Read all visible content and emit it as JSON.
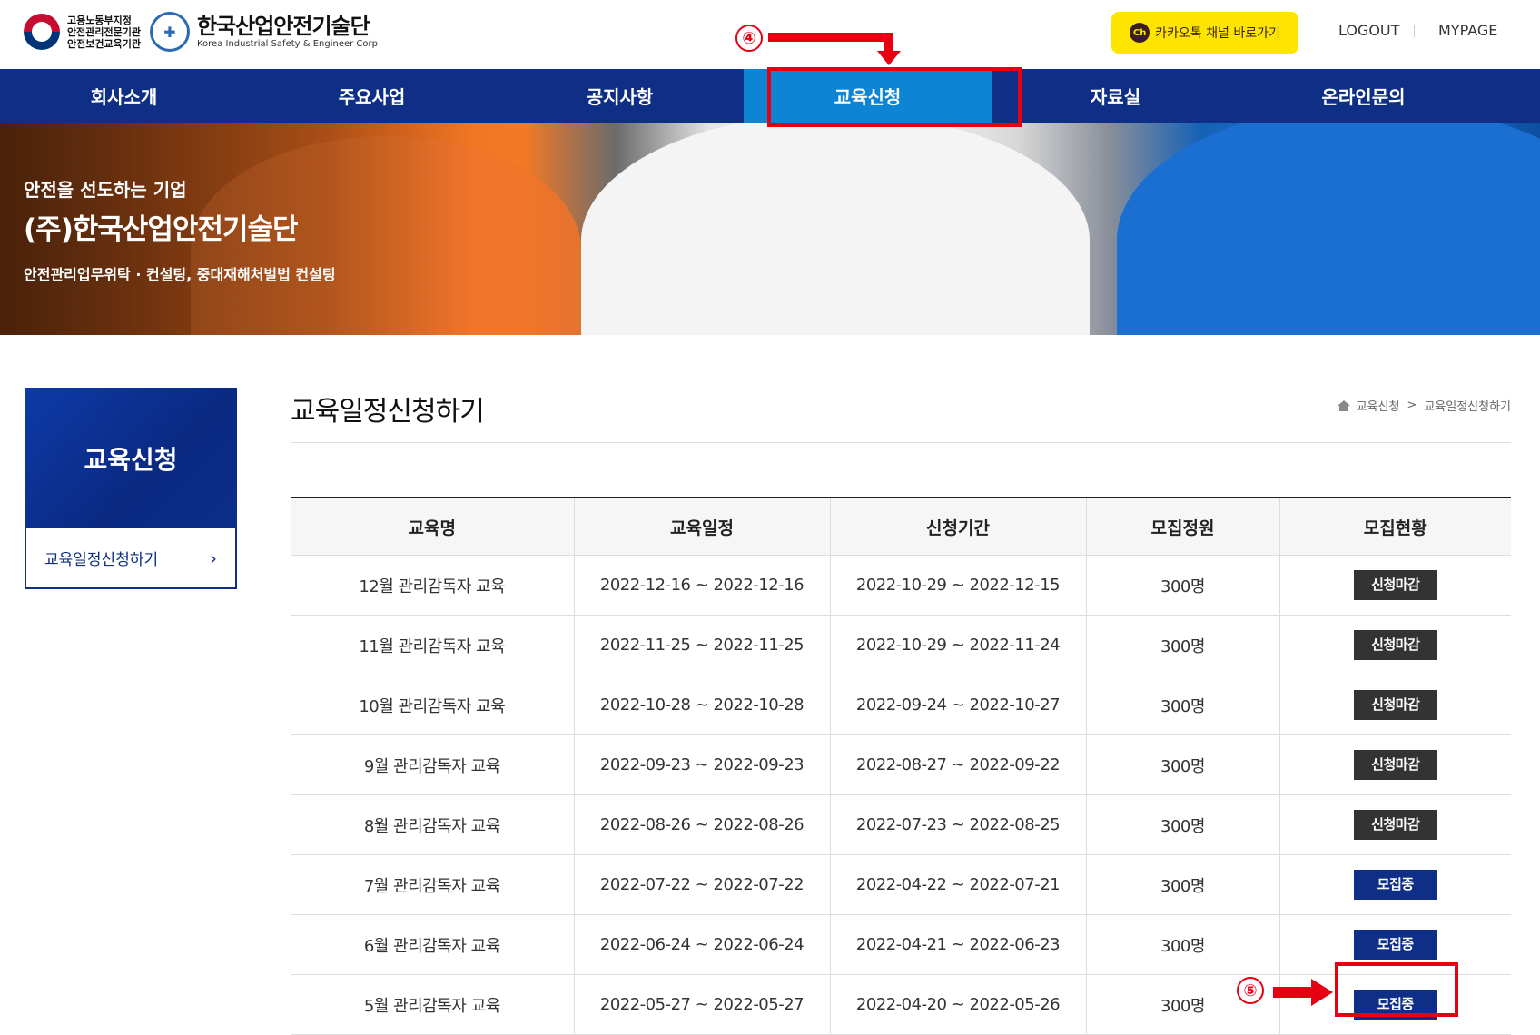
{
  "header": {
    "gov_lines": [
      "고용노동부지정",
      "안전관리전문기관",
      "안전보건교육기관"
    ],
    "brand_ko": "한국산업안전기술단",
    "brand_en": "Korea Industrial Safety & Engineer Corp",
    "kakao_icon": "Ch",
    "kakao_label": "카카오톡 채널 바로가기",
    "logout": "LOGOUT",
    "mypage": "MYPAGE"
  },
  "nav": {
    "items": [
      {
        "label": "회사소개"
      },
      {
        "label": "주요사업"
      },
      {
        "label": "공지사항"
      },
      {
        "label": "교육신청"
      },
      {
        "label": "자료실"
      },
      {
        "label": "온라인문의"
      }
    ],
    "active_index": 3
  },
  "hero": {
    "tagline": "안전을 선도하는 기업",
    "title": "(주)한국산업안전기술단",
    "subtitle": "안전관리업무위탁 · 컨설팅, 중대재해처벌법 컨설팅"
  },
  "sidebar": {
    "title": "교육신청",
    "item_label": "교육일정신청하기",
    "chevron": "›"
  },
  "main": {
    "page_title": "교육일정신청하기",
    "breadcrumb": [
      "교육신청",
      "교육일정신청하기"
    ],
    "breadcrumb_sep": ">"
  },
  "table": {
    "headers": [
      "교육명",
      "교육일정",
      "신청기간",
      "모집정원",
      "모집현황"
    ],
    "rows": [
      {
        "name": "12월 관리감독자 교육",
        "schedule": "2022-12-16 ~ 2022-12-16",
        "period": "2022-10-29 ~ 2022-12-15",
        "capacity": "300명",
        "status": "신청마감",
        "open": false
      },
      {
        "name": "11월 관리감독자 교육",
        "schedule": "2022-11-25 ~ 2022-11-25",
        "period": "2022-10-29 ~ 2022-11-24",
        "capacity": "300명",
        "status": "신청마감",
        "open": false
      },
      {
        "name": "10월 관리감독자 교육",
        "schedule": "2022-10-28 ~ 2022-10-28",
        "period": "2022-09-24 ~ 2022-10-27",
        "capacity": "300명",
        "status": "신청마감",
        "open": false
      },
      {
        "name": "9월 관리감독자 교육",
        "schedule": "2022-09-23 ~ 2022-09-23",
        "period": "2022-08-27 ~ 2022-09-22",
        "capacity": "300명",
        "status": "신청마감",
        "open": false
      },
      {
        "name": "8월 관리감독자 교육",
        "schedule": "2022-08-26 ~ 2022-08-26",
        "period": "2022-07-23 ~ 2022-08-25",
        "capacity": "300명",
        "status": "신청마감",
        "open": false
      },
      {
        "name": "7월 관리감독자 교육",
        "schedule": "2022-07-22 ~ 2022-07-22",
        "period": "2022-04-22 ~ 2022-07-21",
        "capacity": "300명",
        "status": "모집중",
        "open": true
      },
      {
        "name": "6월 관리감독자 교육",
        "schedule": "2022-06-24 ~ 2022-06-24",
        "period": "2022-04-21 ~ 2022-06-23",
        "capacity": "300명",
        "status": "모집중",
        "open": true
      },
      {
        "name": "5월 관리감독자 교육",
        "schedule": "2022-05-27 ~ 2022-05-27",
        "period": "2022-04-20 ~ 2022-05-26",
        "capacity": "300명",
        "status": "모집중",
        "open": true
      }
    ]
  },
  "annotations": {
    "step4": "④",
    "step5": "⑤",
    "color": "#e60012"
  },
  "colors": {
    "nav_bg": "#0f2f86",
    "nav_active": "#0e85d4",
    "kakao": "#fee500",
    "status_closed": "#333333",
    "status_open": "#0f2f86"
  }
}
